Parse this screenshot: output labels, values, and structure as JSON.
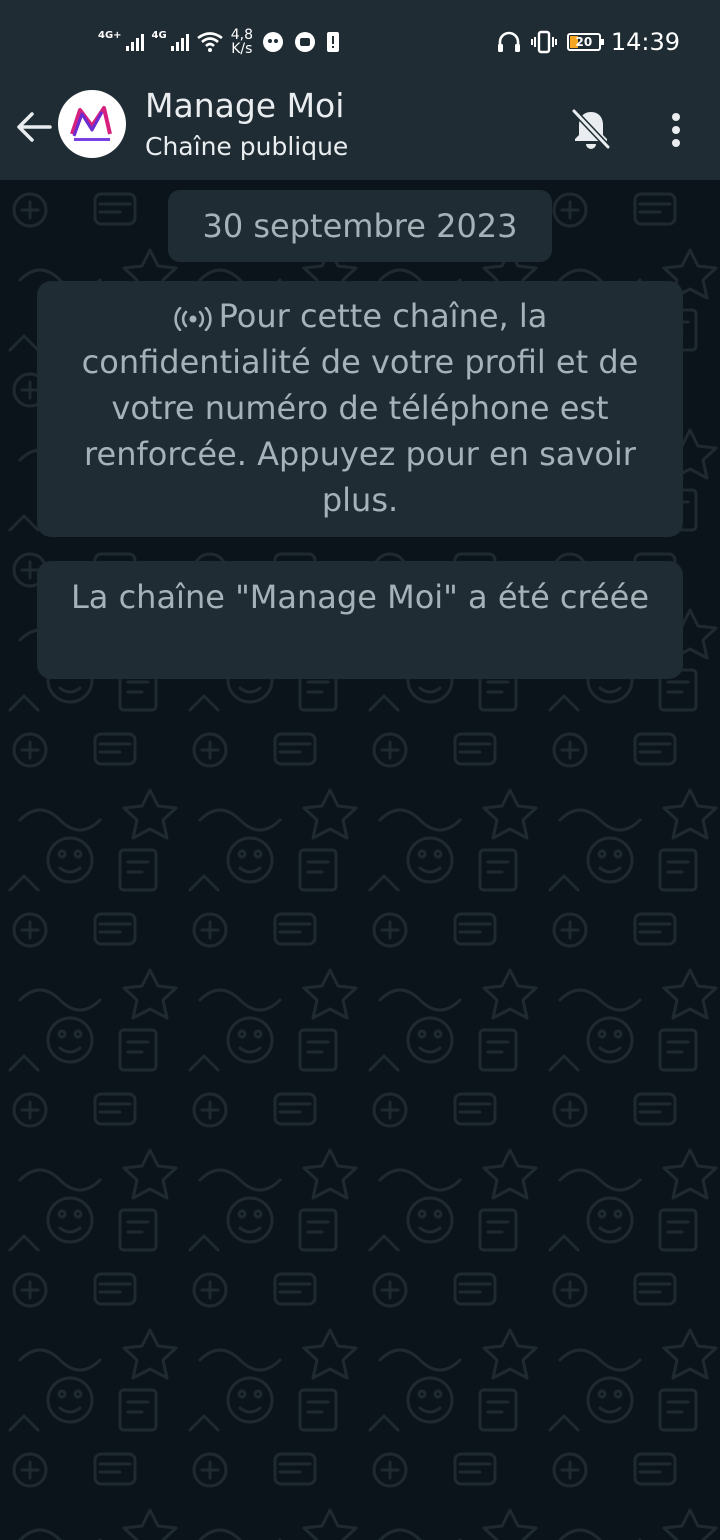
{
  "status_bar": {
    "network1": "4G+",
    "network2": "4G",
    "speed_value": "4,8",
    "speed_unit": "K/s",
    "battery": "20",
    "time": "14:39"
  },
  "header": {
    "title": "Manage Moi",
    "subtitle": "Chaîne publique",
    "icons": [
      "back-arrow-icon",
      "channel-avatar",
      "bell-off-icon",
      "more-vert-icon"
    ]
  },
  "chat": {
    "date_chip": "30 septembre 2023",
    "privacy_notice": "Pour cette chaîne, la confidentialité de votre profil et de votre numéro de téléphone est renforcée. Appuyez pour en savoir plus.",
    "created_notice": "La chaîne \"Manage Moi\" a été créée"
  },
  "colors": {
    "bar_bg": "#1f2c34",
    "chat_bg": "#0b141a",
    "bubble_bg": "#1f2c34",
    "text_muted": "#a6b2b8"
  }
}
